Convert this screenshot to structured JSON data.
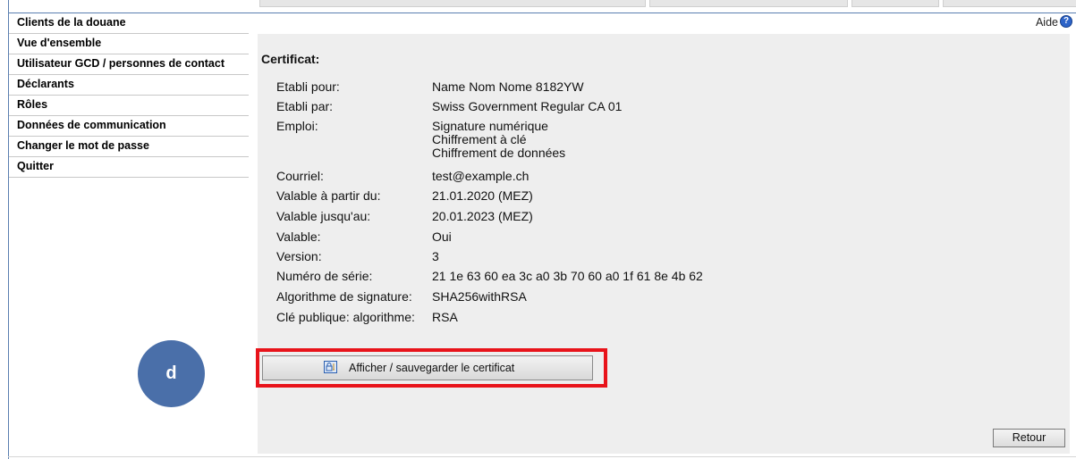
{
  "sidebar": {
    "items": [
      {
        "label": "Clients de la douane"
      },
      {
        "label": "Vue d'ensemble"
      },
      {
        "label": "Utilisateur GCD / personnes de contact"
      },
      {
        "label": "Déclarants"
      },
      {
        "label": "Rôles"
      },
      {
        "label": "Données de communication"
      },
      {
        "label": "Changer le mot de passe"
      },
      {
        "label": "Quitter"
      }
    ]
  },
  "help": {
    "label": "Aide",
    "icon": "help-icon"
  },
  "certificate": {
    "title": "Certificat:",
    "fields": {
      "issued_for": {
        "label": "Etabli pour:",
        "value": "Name Nom Nome 8182YW"
      },
      "issued_by": {
        "label": "Etabli par:",
        "value": "Swiss Government Regular CA 01"
      },
      "usage": {
        "label": "Emploi:",
        "values": [
          "Signature numérique",
          "Chiffrement à clé",
          "Chiffrement de données"
        ]
      },
      "email": {
        "label": "Courriel:",
        "value": "test@example.ch"
      },
      "valid_from": {
        "label": "Valable à partir du:",
        "value": "21.01.2020 (MEZ)"
      },
      "valid_until": {
        "label": "Valable jusqu'au:",
        "value": "20.01.2023 (MEZ)"
      },
      "valid": {
        "label": "Valable:",
        "value": "Oui"
      },
      "version": {
        "label": "Version:",
        "value": "3"
      },
      "serial": {
        "label": "Numéro de série:",
        "value": "21 1e 63 60 ea 3c a0 3b 70 60 a0 1f 61 8e 4b 62"
      },
      "signature_algorithm": {
        "label": "Algorithme de signature:",
        "value": "SHA256withRSA"
      },
      "public_key_algorithm": {
        "label": "Clé publique: algorithme:",
        "value": "RSA"
      }
    }
  },
  "annotation": {
    "label": "d",
    "color": "#4a6fa9",
    "highlight_color": "#e8131a"
  },
  "buttons": {
    "show_save_certificate": "Afficher / sauvegarder le certificat",
    "back": "Retour"
  }
}
